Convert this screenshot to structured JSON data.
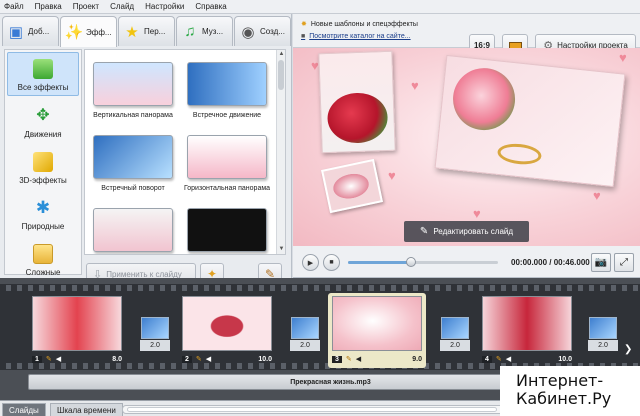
{
  "menu": [
    "Файл",
    "Правка",
    "Проект",
    "Слайд",
    "Настройки",
    "Справка"
  ],
  "tabs": [
    {
      "label": "Доб...",
      "icon": "add-photo-icon"
    },
    {
      "label": "Эфф...",
      "icon": "effects-wand-icon",
      "active": true
    },
    {
      "label": "Пер...",
      "icon": "transition-star-icon"
    },
    {
      "label": "Муз...",
      "icon": "music-note-icon"
    },
    {
      "label": "Созд...",
      "icon": "create-disc-icon"
    }
  ],
  "categories": [
    {
      "label": "Все эффекты",
      "icon": "puzzle-icon",
      "active": true
    },
    {
      "label": "Движения",
      "icon": "move-arrows-icon"
    },
    {
      "label": "3D-эффекты",
      "icon": "cube-icon"
    },
    {
      "label": "Природные",
      "icon": "snowflake-icon"
    },
    {
      "label": "Сложные",
      "icon": "complex-layers-icon"
    }
  ],
  "effects": [
    {
      "label": "Вертикальная панорама"
    },
    {
      "label": "Встречное движение"
    },
    {
      "label": "Встречный поворот"
    },
    {
      "label": "Горизонтальная панорама"
    },
    {
      "label": ""
    },
    {
      "label": ""
    }
  ],
  "apply_label": "Применить к слайду",
  "notice": {
    "line1": "Новые шаблоны и спецэффекты",
    "line2": "Посмотрите каталог на сайте..."
  },
  "ratio_label": "16:9",
  "settings_label": "Настройки проекта",
  "edit_slide_label": "Редактировать слайд",
  "playback": {
    "time": "00:00.000 / 00:46.000",
    "progress": 0.42
  },
  "slides": [
    {
      "num": "1",
      "duration": "8.0"
    },
    {
      "num": "2",
      "duration": "10.0"
    },
    {
      "num": "3",
      "duration": "9.0",
      "selected": true
    },
    {
      "num": "4",
      "duration": "10.0"
    }
  ],
  "transitions": [
    "2.0",
    "2.0",
    "2.0",
    "2.0"
  ],
  "audio_track": "Прекрасная жизнь.mp3",
  "bottom_tabs": {
    "slides": "Слайды",
    "timeline": "Шкала времени"
  },
  "watermark": {
    "line1": "Интернет-",
    "line2": "Кабинет.Ру"
  },
  "colors": {
    "accent_blue": "#6fa5d8",
    "pink": "#f2b9c2",
    "timeline_bg": "#4b4f55"
  }
}
